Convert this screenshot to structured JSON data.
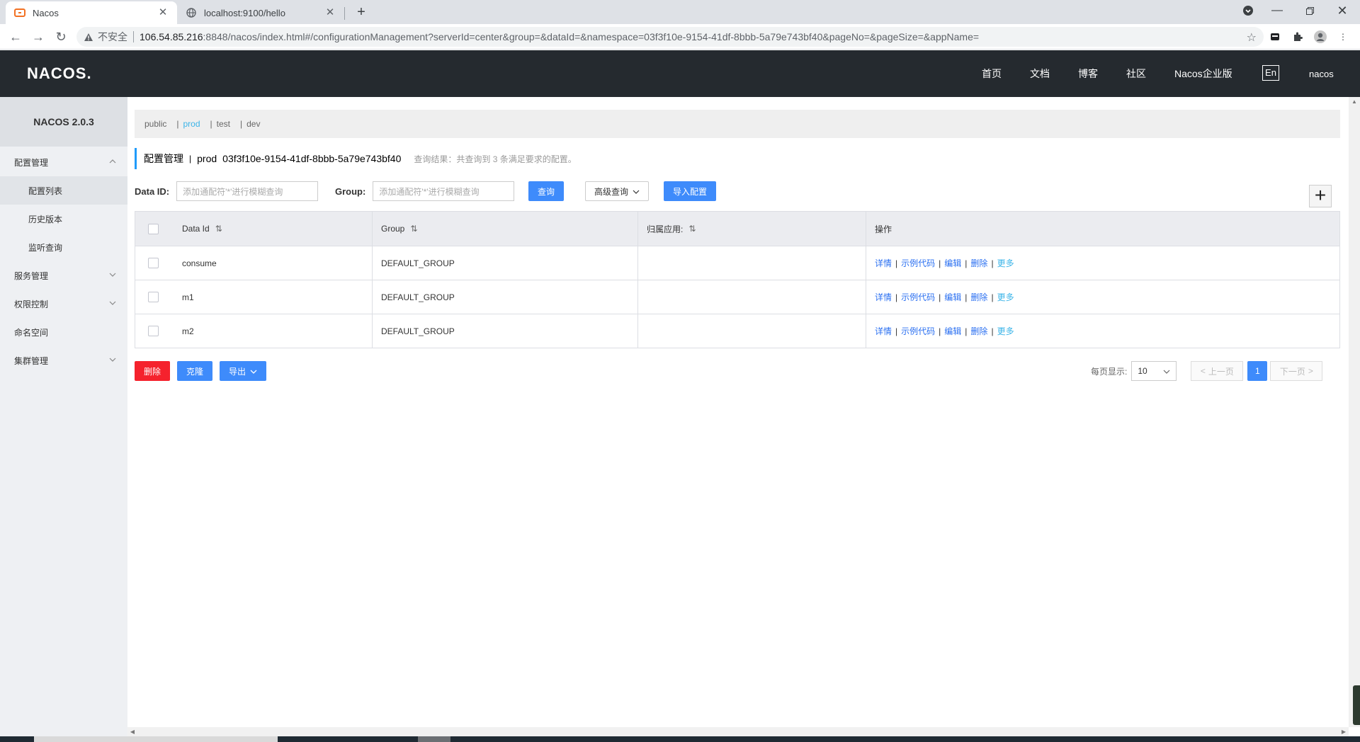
{
  "browser": {
    "tabs": [
      {
        "title": "Nacos",
        "active": true
      },
      {
        "title": "localhost:9100/hello",
        "active": false
      }
    ],
    "security_label": "不安全",
    "url_host": "106.54.85.216",
    "url_path": ":8848/nacos/index.html#/configurationManagement?serverId=center&group=&dataId=&namespace=03f3f10e-9154-41df-8bbb-5a79e743bf40&pageNo=&pageSize=&appName="
  },
  "header": {
    "logo": "NACOS.",
    "nav": [
      "首页",
      "文档",
      "博客",
      "社区",
      "Nacos企业版"
    ],
    "lang": "En",
    "user": "nacos"
  },
  "sidebar": {
    "brand": "NACOS 2.0.3",
    "items": [
      {
        "label": "配置管理",
        "type": "group",
        "expanded": true
      },
      {
        "label": "配置列表",
        "type": "sub",
        "selected": true
      },
      {
        "label": "历史版本",
        "type": "sub"
      },
      {
        "label": "监听查询",
        "type": "sub"
      },
      {
        "label": "服务管理",
        "type": "group",
        "expanded": false
      },
      {
        "label": "权限控制",
        "type": "group",
        "expanded": false
      },
      {
        "label": "命名空间",
        "type": "group"
      },
      {
        "label": "集群管理",
        "type": "group",
        "expanded": false
      }
    ]
  },
  "namespaces": {
    "items": [
      "public",
      "prod",
      "test",
      "dev"
    ],
    "active": "prod",
    "separator": "|"
  },
  "title": {
    "main": "配置管理",
    "sep": "|",
    "namespace": "prod",
    "namespace_id": "03f3f10e-9154-41df-8bbb-5a79e743bf40",
    "result": "查询结果：共查询到 3 条满足要求的配置。"
  },
  "filter": {
    "dataid_label": "Data ID:",
    "dataid_placeholder": "添加通配符'*'进行模糊查询",
    "group_label": "Group:",
    "group_placeholder": "添加通配符'*'进行模糊查询",
    "query_button": "查询",
    "advanced_button": "高级查询",
    "import_button": "导入配置",
    "add_button": "+"
  },
  "table": {
    "columns": [
      "Data Id",
      "Group",
      "归属应用:",
      "操作"
    ],
    "sort_glyph": "⇅",
    "rows": [
      {
        "data_id": "consume",
        "group": "DEFAULT_GROUP",
        "app": ""
      },
      {
        "data_id": "m1",
        "group": "DEFAULT_GROUP",
        "app": ""
      },
      {
        "data_id": "m2",
        "group": "DEFAULT_GROUP",
        "app": ""
      }
    ],
    "ops": [
      "详情",
      "示例代码",
      "编辑",
      "删除",
      "更多"
    ],
    "op_sep": "|"
  },
  "footer": {
    "delete_button": "删除",
    "clone_button": "克隆",
    "export_button": "导出",
    "page_size_label": "每页显示:",
    "page_size": "10",
    "prev": "上一页",
    "next": "下一页",
    "current_page": "1"
  },
  "colors": {
    "header_bg": "#252a2f",
    "primary": "#3e8bfb",
    "danger": "#f5222d",
    "link": "#2a6ff1",
    "active_ns": "#3bb4e8"
  }
}
